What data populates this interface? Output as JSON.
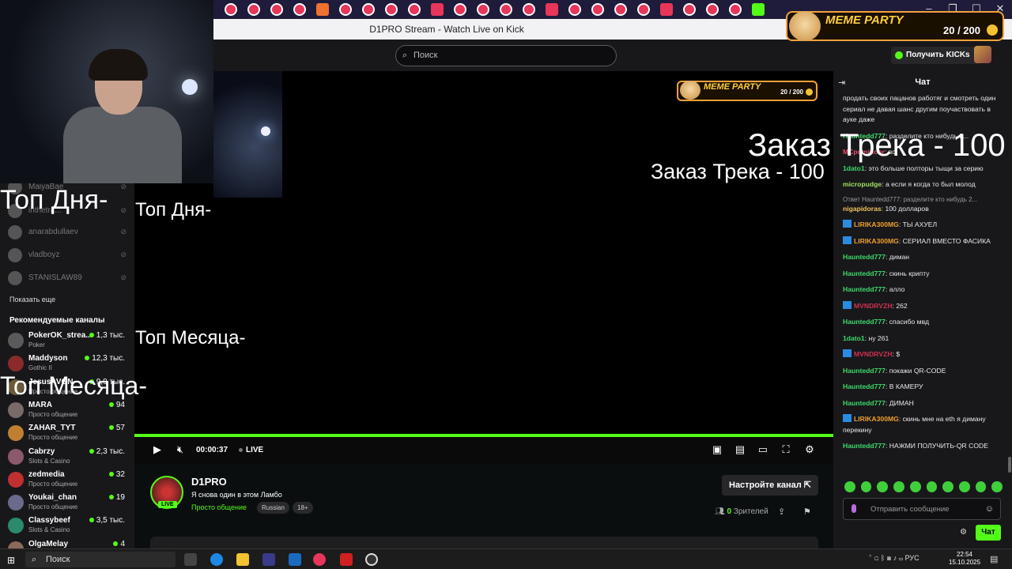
{
  "browser": {
    "window_title": "D1PRO Stream - Watch Live on Kick",
    "tab_icons": [
      "yandex-icon",
      "yandex-icon",
      "yandex-icon",
      "yandex-icon",
      "mk-icon",
      "yandex-icon",
      "yandex-icon",
      "yandex-icon",
      "telegram-icon",
      "circle-icon",
      "circle-icon",
      "green-icon",
      "plus-red-icon",
      "wb-icon",
      "yandex-icon",
      "chess-icon",
      "check-icon",
      "r-icon",
      "check-dark-icon",
      "youtube-icon",
      "youtube-icon",
      "youtube-icon",
      "g-icon",
      "kick-icon"
    ]
  },
  "search": {
    "placeholder": "Поиск"
  },
  "header": {
    "kicks_button": "Получить KICKs"
  },
  "meme_party": {
    "title": "MEME PARTY",
    "count": "20 / 200"
  },
  "overlay": {
    "top_day": "Топ Дня-",
    "top_month": "Топ Месяца-",
    "track_order": "Заказ Трека - 100"
  },
  "sidebar": {
    "following": [
      {
        "name": "MaiyaBae"
      },
      {
        "name": "inthetra..."
      },
      {
        "name": "anarabdullaev"
      },
      {
        "name": "vladboyz"
      },
      {
        "name": "STANISLAW89"
      }
    ],
    "show_more": "Показать еще",
    "recommended_title": "Рекомендуемые каналы",
    "recommended": [
      {
        "name": "PokerOK_strea...",
        "category": "Poker",
        "viewers": "1,3 тыс.",
        "color": "#5a5a5a"
      },
      {
        "name": "Maddyson",
        "category": "Gothic II",
        "viewers": "12,3 тыс.",
        "color": "#8a2a2a"
      },
      {
        "name": "JesusAVGN",
        "category": "Просто общение",
        "viewers": "9,9 тыс.",
        "color": "#6a5a3a"
      },
      {
        "name": "MARA",
        "category": "Просто общение",
        "viewers": "94",
        "color": "#7a6a6a"
      },
      {
        "name": "ZAHAR_TYT",
        "category": "Просто общение",
        "viewers": "57",
        "color": "#c08030"
      },
      {
        "name": "Cabrzy",
        "category": "Slots & Casino",
        "viewers": "2,3 тыс.",
        "color": "#8a5a6a"
      },
      {
        "name": "zedmedia",
        "category": "Просто общение",
        "viewers": "32",
        "color": "#c03030"
      },
      {
        "name": "Youkai_chan",
        "category": "Просто общение",
        "viewers": "19",
        "color": "#6a6a8a"
      },
      {
        "name": "Classybeef",
        "category": "Slots & Casino",
        "viewers": "3,5 тыс.",
        "color": "#2a8a6a"
      },
      {
        "name": "OlgaMelay",
        "category": "",
        "viewers": "4",
        "color": "#8a6a5a"
      }
    ]
  },
  "player": {
    "time": "00:00:37",
    "live": "LIVE",
    "progress": 1.0
  },
  "channel": {
    "name": "D1PRO",
    "live_badge": "LIVE",
    "title": "Я снова один в этом Ламбо",
    "category": "Просто общение",
    "tags": [
      "Russian",
      "18+"
    ],
    "setup_button": "Настройте канал",
    "viewers_count": "0",
    "viewers_label": "Зрителей"
  },
  "chat": {
    "title": "Чат",
    "messages": [
      {
        "user": "",
        "text": "продать своих пацанов работяг и смотреть один сериал не давая шанс другим поучаствовать в ауке даже",
        "color": "#ffffff"
      },
      {
        "user": "Hauntedd777",
        "text": "разделите кто нибудь 2...",
        "color": "#3fd96a"
      },
      {
        "user": "MCpomidoor",
        "text": "во",
        "color": "#e84a6a"
      },
      {
        "user": "1dato1",
        "text": "это больше полторы тыщи за серию",
        "color": "#3fd96a"
      },
      {
        "user": "micropudge",
        "text": "а если я когда то был молод",
        "color": "#a0e060"
      },
      {
        "reply": "Ответ Hauntedd777: разделите кто нибудь 2...",
        "user": "nigapidoras",
        "text": "100 долларов",
        "color": "#f0c060"
      },
      {
        "user": "LIRIKA300MG",
        "text": "ТЫ АХУЕЛ",
        "color": "#f0a030",
        "badge": true
      },
      {
        "user": "LIRIKA300MG",
        "text": "СЕРИАЛ ВМЕСТО ФАСИКА",
        "color": "#f0a030",
        "badge": true
      },
      {
        "user": "Hauntedd777",
        "text": "диман",
        "color": "#3fd96a"
      },
      {
        "user": "Hauntedd777",
        "text": "скинь крипту",
        "color": "#3fd96a"
      },
      {
        "user": "Hauntedd777",
        "text": "алло",
        "color": "#3fd96a"
      },
      {
        "user": "MVNDRVZH",
        "text": "262",
        "color": "#d03050",
        "badge": true
      },
      {
        "user": "Hauntedd777",
        "text": "спасибо мвд",
        "color": "#3fd96a"
      },
      {
        "user": "1dato1",
        "text": "ну 261",
        "color": "#3fd96a"
      },
      {
        "user": "MVNDRVZH",
        "text": "$",
        "color": "#d03050",
        "badge": true
      },
      {
        "user": "Hauntedd777",
        "text": "покажи QR-CODE",
        "color": "#3fd96a"
      },
      {
        "user": "Hauntedd777",
        "text": "В КАМЕРУ",
        "color": "#3fd96a"
      },
      {
        "user": "Hauntedd777",
        "text": "ДИМАН",
        "color": "#3fd96a"
      },
      {
        "user": "LIRIKA300MG",
        "text": "скинь мне на eth я диману перекину",
        "color": "#f0a030",
        "badge": true
      },
      {
        "user": "Hauntedd777",
        "text": "НАЖМИ ПОЛУЧИТЬ-QR CODE",
        "color": "#3fd96a"
      }
    ],
    "input_placeholder": "Отправить сообщение",
    "send_button": "Чат"
  },
  "taskbar": {
    "search_label": "Поиск",
    "tray_lang": "РУС",
    "time": "22:54",
    "date": "15.10.2025"
  },
  "colors": {
    "accent": "#53fc18",
    "bg": "#0b0e0f",
    "panel": "#18181b"
  }
}
